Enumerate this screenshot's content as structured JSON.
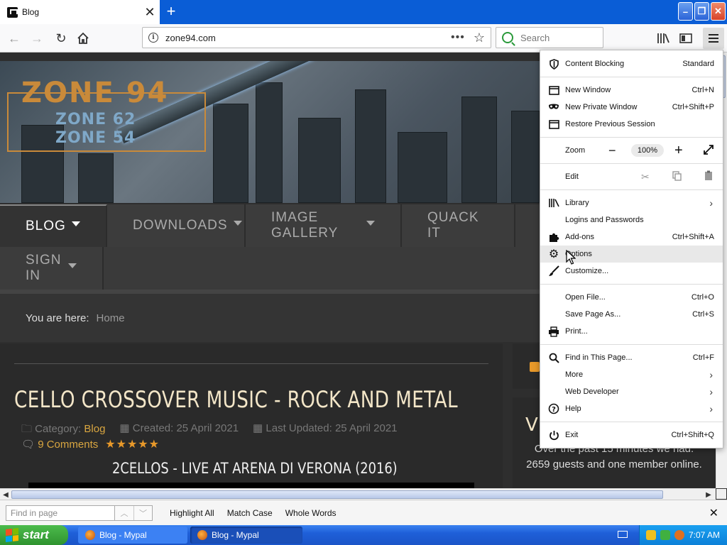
{
  "browser": {
    "tab_title": "Blog",
    "url": "zone94.com",
    "search_placeholder": "Search"
  },
  "site": {
    "logo_main": "ZONE 94",
    "logo_sub1": "ZONE 62",
    "logo_sub2": "ZONE 54",
    "nav": [
      {
        "label": "BLOG"
      },
      {
        "label": "DOWNLOADS"
      },
      {
        "label": "IMAGE GALLERY"
      },
      {
        "label": "QUACK IT"
      },
      {
        "label": "SIGN IN"
      }
    ],
    "breadcrumb_label": "You are here:",
    "breadcrumb_home": "Home",
    "article": {
      "title": "CELLO CROSSOVER MUSIC - ROCK AND METAL",
      "category_label": "Category:",
      "category": "Blog",
      "created": "Created: 25 April 2021",
      "updated": "Last Updated: 25 April 2021",
      "comments": "9 Comments",
      "stars": "★★★★★",
      "subtitle": "2CELLOS - LIVE AT ARENA DI VERONA (2016)"
    },
    "sidebar": {
      "heading": "VI",
      "stats": "Over the past 15 minutes we had: 2659 guests and one member online."
    }
  },
  "menu": {
    "content_blocking": "Content Blocking",
    "content_blocking_value": "Standard",
    "new_window": "New Window",
    "new_window_sc": "Ctrl+N",
    "private_window": "New Private Window",
    "private_window_sc": "Ctrl+Shift+P",
    "restore_session": "Restore Previous Session",
    "zoom": "Zoom",
    "zoom_value": "100%",
    "edit": "Edit",
    "library": "Library",
    "logins": "Logins and Passwords",
    "addons": "Add-ons",
    "addons_sc": "Ctrl+Shift+A",
    "options": "Options",
    "customize": "Customize...",
    "open_file": "Open File...",
    "open_file_sc": "Ctrl+O",
    "save_page": "Save Page As...",
    "save_page_sc": "Ctrl+S",
    "print": "Print...",
    "find": "Find in This Page...",
    "find_sc": "Ctrl+F",
    "more": "More",
    "web_developer": "Web Developer",
    "help": "Help",
    "exit": "Exit",
    "exit_sc": "Ctrl+Shift+Q"
  },
  "findbar": {
    "placeholder": "Find in page",
    "highlight_all": "Highlight All",
    "match_case": "Match Case",
    "whole_words": "Whole Words"
  },
  "taskbar": {
    "start": "start",
    "item1": "Blog - Mypal",
    "item2": "Blog - Mypal",
    "clock": "7:07 AM"
  }
}
